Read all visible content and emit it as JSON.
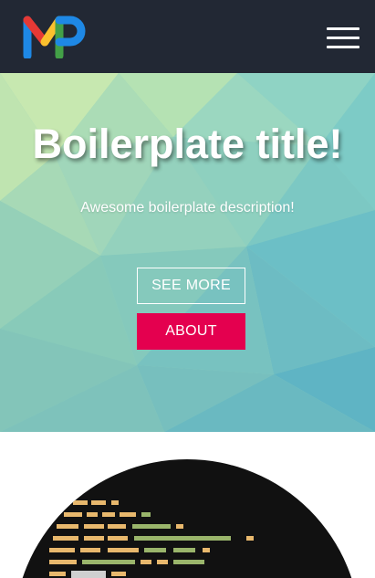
{
  "navbar": {
    "logo_alt": "MP",
    "menu_icon": "hamburger-menu-icon"
  },
  "hero": {
    "title": "Boilerplate title!",
    "description": "Awesome boilerplate description!",
    "see_more_label": "SEE MORE",
    "about_label": "ABOUT"
  },
  "colors": {
    "navbar_bg": "#222834",
    "accent": "#e4004f",
    "logo_red": "#e53935",
    "logo_blue": "#1e88e5",
    "logo_green": "#43a047",
    "logo_yellow": "#fbc02d"
  },
  "content_image": "code-editor-circle-image"
}
